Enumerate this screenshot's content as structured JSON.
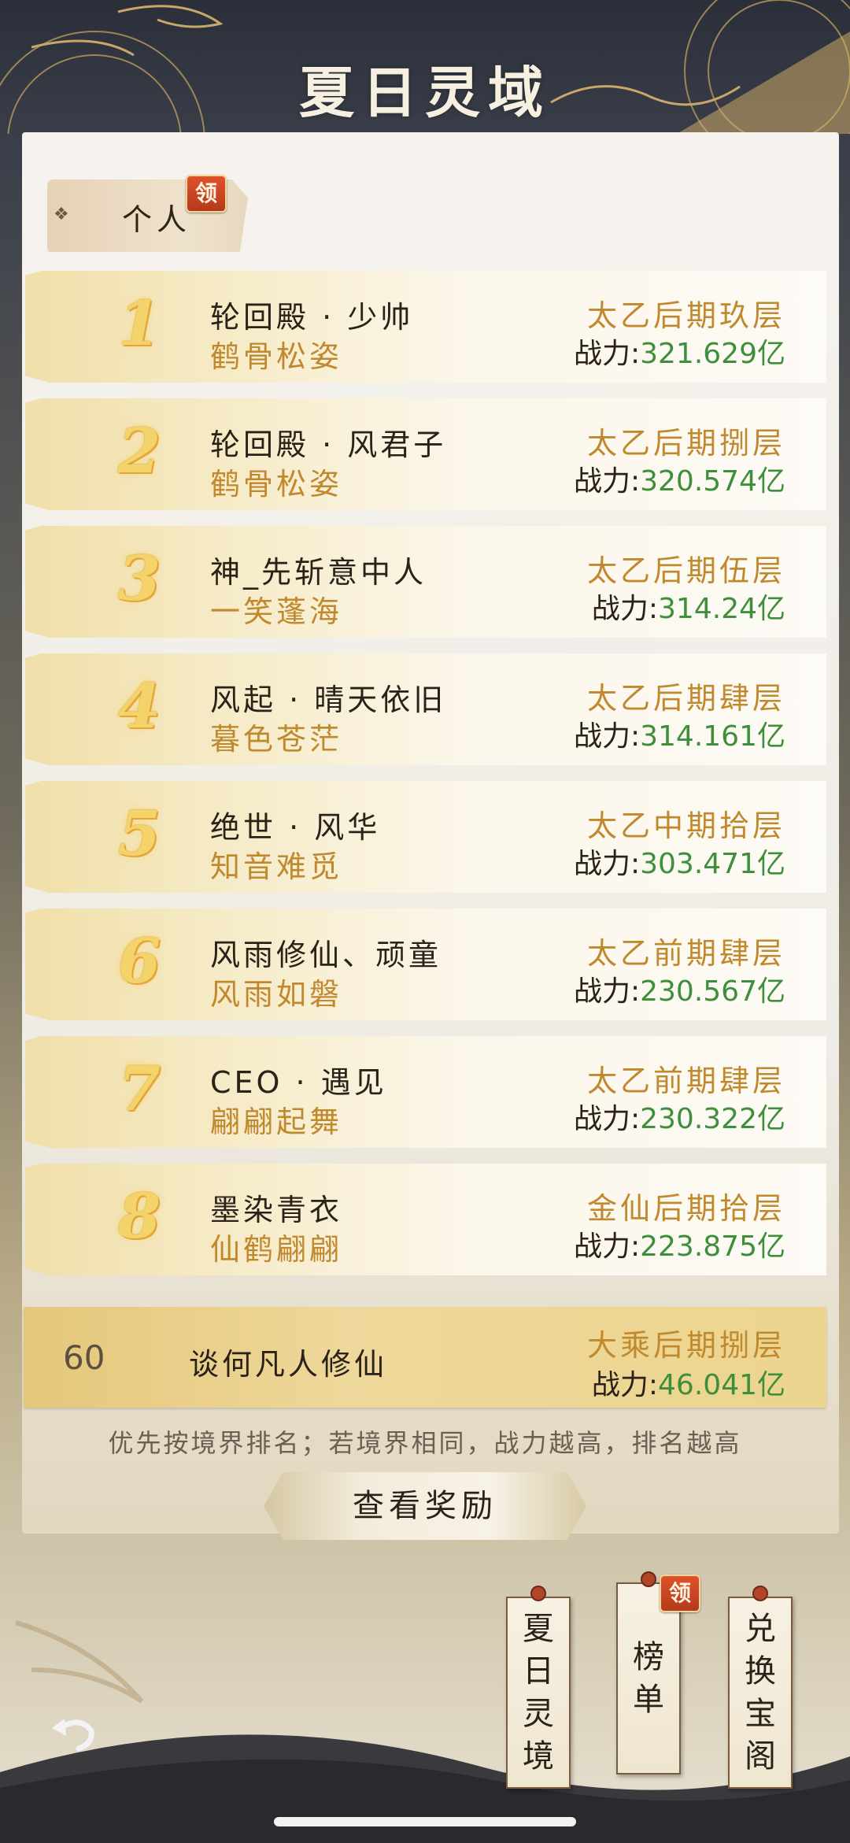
{
  "header": {
    "title": "夏日灵域"
  },
  "tabs": {
    "personal_label": "个人",
    "claim_badge": "领"
  },
  "ranking": [
    {
      "rank": "1",
      "name": "轮回殿 · 少帅",
      "guild": "鹤骨松姿",
      "realm": "太乙后期玖层",
      "power_label": "战力:",
      "power_value": "321.629亿"
    },
    {
      "rank": "2",
      "name": "轮回殿 · 风君子",
      "guild": "鹤骨松姿",
      "realm": "太乙后期捌层",
      "power_label": "战力:",
      "power_value": "320.574亿"
    },
    {
      "rank": "3",
      "name": "神_先斩意中人",
      "guild": "一笑蓬海",
      "realm": "太乙后期伍层",
      "power_label": "战力:",
      "power_value": "314.24亿"
    },
    {
      "rank": "4",
      "name": "风起 · 晴天依旧",
      "guild": "暮色苍茫",
      "realm": "太乙后期肆层",
      "power_label": "战力:",
      "power_value": "314.161亿"
    },
    {
      "rank": "5",
      "name": "绝世 · 风华",
      "guild": "知音难觅",
      "realm": "太乙中期拾层",
      "power_label": "战力:",
      "power_value": "303.471亿"
    },
    {
      "rank": "6",
      "name": "风雨修仙、顽童",
      "guild": "风雨如磐",
      "realm": "太乙前期肆层",
      "power_label": "战力:",
      "power_value": "230.567亿"
    },
    {
      "rank": "7",
      "name": "CEO · 遇见",
      "guild": "翩翩起舞",
      "realm": "太乙前期肆层",
      "power_label": "战力:",
      "power_value": "230.322亿"
    },
    {
      "rank": "8",
      "name": "墨染青衣",
      "guild": "仙鹤翩翩",
      "realm": "金仙后期拾层",
      "power_label": "战力:",
      "power_value": "223.875亿"
    }
  ],
  "me": {
    "rank": "60",
    "name": "谈何凡人修仙",
    "realm": "大乘后期捌层",
    "power_label": "战力:",
    "power_value": "46.041亿"
  },
  "rule_note": "优先按境界排名；若境界相同，战力越高，排名越高",
  "reward_button": "查看奖励",
  "bottom_tags": {
    "tag1": [
      "夏",
      "日",
      "灵",
      "境"
    ],
    "tag2": [
      "榜",
      "单"
    ],
    "tag3": [
      "兑",
      "换",
      "宝",
      "阁"
    ],
    "tag2_badge": "领"
  },
  "colors": {
    "realm": "#c0892e",
    "power_value": "#3f8e3b",
    "badge": "#c7431f"
  }
}
